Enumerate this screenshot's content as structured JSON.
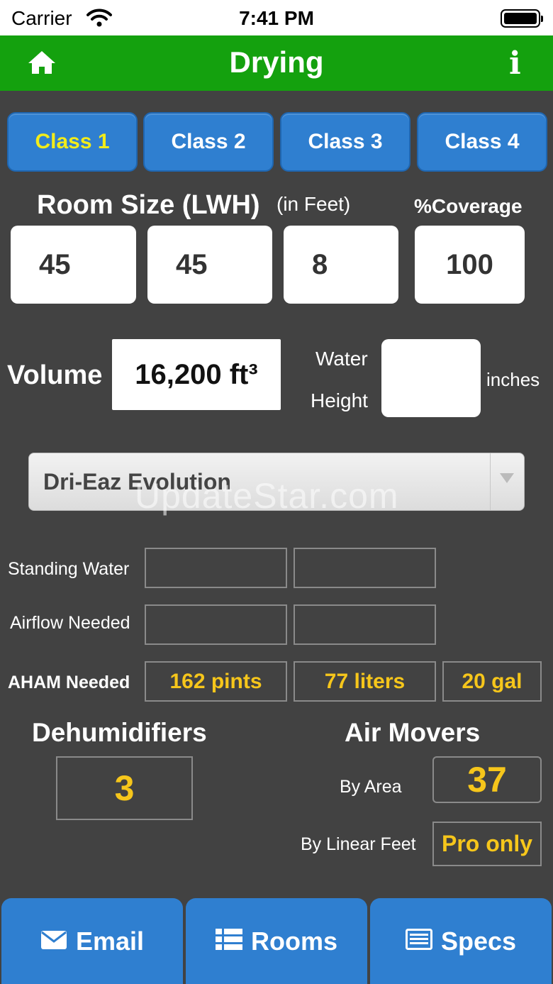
{
  "status_bar": {
    "carrier": "Carrier",
    "time": "7:41 PM"
  },
  "nav": {
    "title": "Drying",
    "info_label": "i"
  },
  "classes": [
    "Class 1",
    "Class 2",
    "Class 3",
    "Class 4"
  ],
  "room_size": {
    "label": "Room Size (LWH)",
    "unit_label": "(in Feet)",
    "coverage_label": "%Coverage",
    "length": "45",
    "width": "45",
    "height": "8",
    "coverage": "100"
  },
  "volume": {
    "label": "Volume",
    "value": "16,200 ft³"
  },
  "water_height": {
    "label_line1": "Water",
    "label_line2": "Height",
    "value": "",
    "unit": "inches"
  },
  "dehumidifier_model": "Dri-Eaz Evolution",
  "watermark": "UpdateStar.com",
  "rows": {
    "standing_water": {
      "label": "Standing Water",
      "values": [
        "",
        ""
      ]
    },
    "airflow_needed": {
      "label": "Airflow Needed",
      "values": [
        "",
        ""
      ]
    },
    "aham_needed": {
      "label": "AHAM Needed",
      "values": [
        "162 pints",
        "77 liters",
        "20 gal"
      ]
    }
  },
  "dehumidifiers": {
    "label": "Dehumidifiers",
    "value": "3"
  },
  "air_movers": {
    "label": "Air Movers",
    "by_area_label": "By Area",
    "by_area_value": "37",
    "by_linear_label": "By Linear Feet",
    "by_linear_value": "Pro only"
  },
  "bottom_bar": {
    "email": "Email",
    "rooms": "Rooms",
    "specs": "Specs"
  },
  "colors": {
    "nav_green": "#14a10e",
    "button_blue": "#2f7fd0",
    "accent_yellow": "#f6c61b",
    "background": "#424242"
  }
}
